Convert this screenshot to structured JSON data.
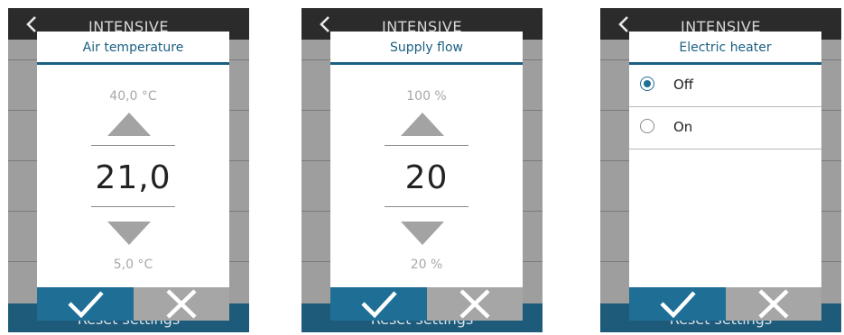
{
  "screens": [
    {
      "background_title": "INTENSIVE",
      "background_footer": "Reset settings",
      "dialog": {
        "title": "Air temperature",
        "max_label": "40,0 °C",
        "value": "21,0",
        "min_label": "5,0 °C"
      }
    },
    {
      "background_title": "INTENSIVE",
      "background_footer": "Reset settings",
      "dialog": {
        "title": "Supply flow",
        "max_label": "100 %",
        "value": "20",
        "min_label": "20 %"
      }
    },
    {
      "background_title": "INTENSIVE",
      "background_footer": "Reset settings",
      "dialog": {
        "title": "Electric heater",
        "options": [
          {
            "label": "Off",
            "selected": true
          },
          {
            "label": "On",
            "selected": false
          }
        ]
      }
    }
  ],
  "colors": {
    "accent": "#1f6e96",
    "title": "#1a5f82",
    "cancel": "#a6a6a6",
    "backdrop": "#9e9e9e",
    "topbar": "#2b2b2b"
  },
  "icons": {
    "back": "chevron-left-icon",
    "increase": "triangle-up-icon",
    "decrease": "triangle-down-icon",
    "confirm": "check-icon",
    "cancel": "close-icon"
  }
}
